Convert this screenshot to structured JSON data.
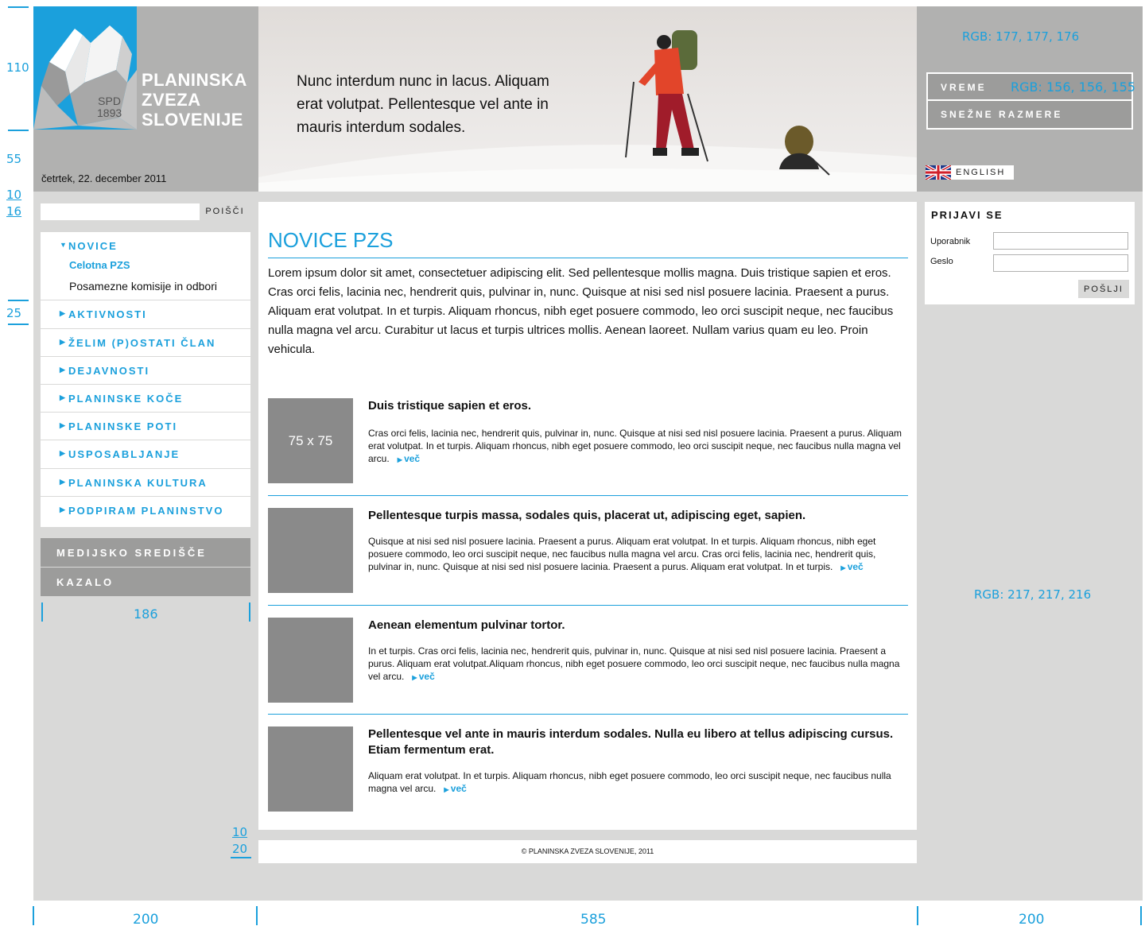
{
  "header": {
    "logo_lines": [
      "PLANINSKA",
      "ZVEZA",
      "SLOVENIJE"
    ],
    "logo_spd": "SPD",
    "logo_year": "1893",
    "date": "četrtek, 22. december 2011",
    "hero_text": "Nunc interdum nunc in lacus. Aliquam erat volutpat. Pellentesque vel ante in mauris interdum sodales.",
    "vreme_label": "VREME",
    "snezne_label": "SNEŽNE RAZMERE",
    "english_label": "ENGLISH"
  },
  "search": {
    "button_label": "POIŠČI"
  },
  "nav": {
    "active_label": "NOVICE",
    "sub_items": [
      "Celotna PZS",
      "Posamezne komisije in odbori"
    ],
    "items": [
      "AKTIVNOSTI",
      "ŽELIM (P)OSTATI ČLAN",
      "DEJAVNOSTI",
      "PLANINSKE KOČE",
      "PLANINSKE POTI",
      "USPOSABLJANJE",
      "PLANINSKA KULTURA",
      "PODPIRAM PLANINSTVO"
    ],
    "gray_items": [
      "MEDIJSKO SREDIŠČE",
      "KAZALO"
    ]
  },
  "main": {
    "title": "NOVICE PZS",
    "intro": "Lorem ipsum dolor sit amet, consectetuer adipiscing elit. Sed pellentesque mollis magna. Duis tristique sapien et eros. Cras orci felis, lacinia nec, hendrerit quis, pulvinar in, nunc. Quisque at nisi sed nisl posuere lacinia. Praesent a purus. Aliquam erat volutpat. In et turpis. Aliquam rhoncus, nibh eget posuere commodo, leo orci suscipit neque, nec faucibus nulla magna vel arcu. Curabitur ut lacus et turpis ultrices mollis. Aenean laoreet. Nullam varius quam eu leo. Proin vehicula.",
    "more_label": "več",
    "articles": [
      {
        "thumb_label": "75 x 75",
        "title": "Duis tristique sapien et eros.",
        "body": "Cras orci felis, lacinia nec, hendrerit quis, pulvinar in, nunc. Quisque at nisi sed nisl posuere lacinia. Praesent a purus. Aliquam erat volutpat. In et turpis. Aliquam rhoncus, nibh eget posuere commodo, leo orci suscipit neque, nec faucibus nulla magna vel arcu."
      },
      {
        "thumb_label": "",
        "title": "Pellentesque turpis massa, sodales quis, placerat ut, adipiscing eget, sapien.",
        "body": "Quisque at nisi sed nisl posuere lacinia. Praesent a purus. Aliquam erat volutpat. In et turpis. Aliquam rhoncus, nibh eget posuere commodo, leo orci suscipit neque, nec faucibus nulla magna vel arcu. Cras orci felis, lacinia nec, hendrerit quis, pulvinar in, nunc. Quisque at nisi sed nisl posuere lacinia. Praesent a purus. Aliquam erat volutpat. In et turpis."
      },
      {
        "thumb_label": "",
        "title": "Aenean elementum pulvinar tortor.",
        "body": "In et turpis. Cras orci felis, lacinia nec, hendrerit quis, pulvinar in, nunc. Quisque at nisi sed nisl posuere lacinia. Praesent a purus. Aliquam erat volutpat.Aliquam rhoncus, nibh eget posuere commodo, leo orci suscipit neque, nec faucibus nulla magna vel arcu."
      },
      {
        "thumb_label": "",
        "title": "Pellentesque vel ante in mauris interdum sodales. Nulla eu libero at tellus adipiscing cursus. Etiam fermentum erat.",
        "body": "Aliquam erat volutpat. In et turpis. Aliquam rhoncus, nibh eget posuere commodo, leo orci suscipit neque, nec faucibus nulla magna vel arcu."
      }
    ]
  },
  "footer": {
    "copyright": "© PLANINSKA ZVEZA SLOVENIJE, 2011"
  },
  "login": {
    "title": "PRIJAVI SE",
    "user_label": "Uporabnik",
    "pass_label": "Geslo",
    "user_value": "",
    "pass_value": "",
    "submit_label": "POŠLJI"
  },
  "annotations": {
    "left_110": "110",
    "left_55": "55",
    "left_10a": "10",
    "left_16": "16",
    "left_25": "25",
    "nav_width": "186",
    "footer_10": "10",
    "footer_20": "20",
    "col_left": "200",
    "col_mid": "585",
    "col_right": "200",
    "rgb_header": "RGB: 177, 177, 176",
    "rgb_button": "RGB: 156, 156, 155",
    "rgb_bg": "RGB: 217, 217, 216"
  },
  "colors": {
    "accent": "#1ba0dc",
    "header_gray": "#b1b1b0",
    "button_gray": "#9c9c9b",
    "bg_gray": "#d9d9d8"
  }
}
